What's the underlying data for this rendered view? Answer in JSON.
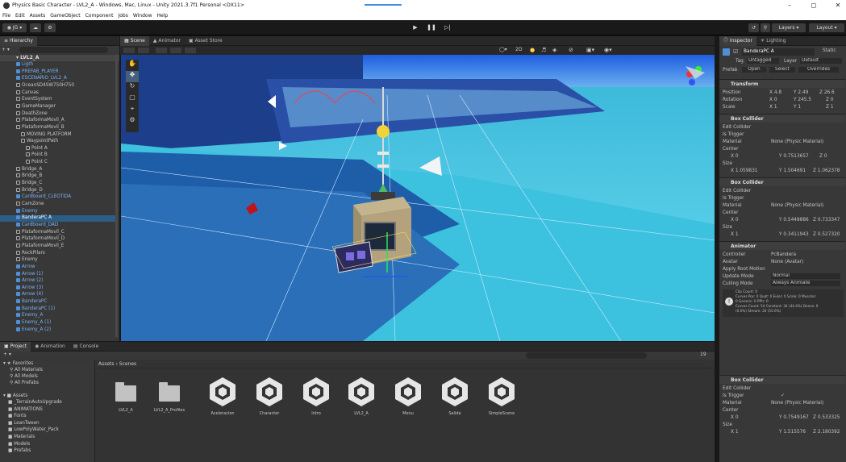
{
  "window": {
    "title": "Physics Basic Character - LVL2_A - Windows, Mac, Linux - Unity 2021.3.7f1 Personal <DX11>"
  },
  "menu": [
    "File",
    "Edit",
    "Assets",
    "GameObject",
    "Component",
    "Jobs",
    "Window",
    "Help"
  ],
  "toolbar": {
    "account": "JG",
    "layers": "Layers",
    "layout": "Layout"
  },
  "hierarchy": {
    "tab": "Hierarchy",
    "scene": "LVL2_A",
    "items": [
      {
        "label": "Ligth",
        "kind": "prefab",
        "indent": 1
      },
      {
        "label": "PREFAB_PLAYER",
        "kind": "prefab",
        "indent": 1
      },
      {
        "label": "ESCENARIO_LVL2_A",
        "kind": "prefab",
        "indent": 1
      },
      {
        "label": "OceanSD4SW750H750",
        "kind": "obj",
        "indent": 1
      },
      {
        "label": "Canvas",
        "kind": "obj",
        "indent": 1
      },
      {
        "label": "EventSystem",
        "kind": "obj",
        "indent": 1
      },
      {
        "label": "GameManager",
        "kind": "obj",
        "indent": 1
      },
      {
        "label": "DeathZone",
        "kind": "obj",
        "indent": 1
      },
      {
        "label": "PlataformaMovil_A",
        "kind": "obj",
        "indent": 1
      },
      {
        "label": "PlataformaMovil_B",
        "kind": "obj",
        "indent": 1
      },
      {
        "label": "MOVING PLATFORM",
        "kind": "obj",
        "indent": 2
      },
      {
        "label": "WaypointPath",
        "kind": "obj",
        "indent": 2
      },
      {
        "label": "Point A",
        "kind": "obj",
        "indent": 3
      },
      {
        "label": "Point B",
        "kind": "obj",
        "indent": 3
      },
      {
        "label": "Point C",
        "kind": "obj",
        "indent": 3
      },
      {
        "label": "Bridge_A",
        "kind": "obj",
        "indent": 1
      },
      {
        "label": "Bridge_B",
        "kind": "obj",
        "indent": 1
      },
      {
        "label": "Bridge_C",
        "kind": "obj",
        "indent": 1
      },
      {
        "label": "Bridge_D",
        "kind": "obj",
        "indent": 1
      },
      {
        "label": "Cardboard_CLEOTIDA",
        "kind": "prefab",
        "indent": 1
      },
      {
        "label": "CamZone",
        "kind": "obj",
        "indent": 1
      },
      {
        "label": "Enemy",
        "kind": "prefab",
        "indent": 1
      },
      {
        "label": "BanderaPC A",
        "kind": "prefab",
        "indent": 1,
        "selected": true
      },
      {
        "label": "Cardboard_DAD",
        "kind": "prefab",
        "indent": 1
      },
      {
        "label": "PlataformaMovil_C",
        "kind": "obj",
        "indent": 1
      },
      {
        "label": "PlataformaMovil_D",
        "kind": "obj",
        "indent": 1
      },
      {
        "label": "PlataformaMovil_E",
        "kind": "obj",
        "indent": 1
      },
      {
        "label": "RockPilars",
        "kind": "obj",
        "indent": 1
      },
      {
        "label": "Enemy",
        "kind": "obj",
        "indent": 1
      },
      {
        "label": "Arrow",
        "kind": "prefab",
        "indent": 1
      },
      {
        "label": "Arrow (1)",
        "kind": "prefab",
        "indent": 1
      },
      {
        "label": "Arrow (2)",
        "kind": "prefab",
        "indent": 1
      },
      {
        "label": "Arrow (3)",
        "kind": "prefab",
        "indent": 1
      },
      {
        "label": "Arrow (4)",
        "kind": "prefab",
        "indent": 1
      },
      {
        "label": "BanderaPC",
        "kind": "prefab",
        "indent": 1
      },
      {
        "label": "BanderaPC (1)",
        "kind": "prefab",
        "indent": 1
      },
      {
        "label": "Enemy_A",
        "kind": "prefab",
        "indent": 1
      },
      {
        "label": "Enemy_A (1)",
        "kind": "prefab",
        "indent": 1
      },
      {
        "label": "Enemy_A (2)",
        "kind": "prefab",
        "indent": 1
      }
    ]
  },
  "scene_tabs": [
    "Scene",
    "Animator",
    "Asset Store"
  ],
  "scene_toolbar": {
    "mode": "2D"
  },
  "inspector": {
    "tabs": [
      "Inspector",
      "Lighting"
    ],
    "object_name": "BanderaPC A",
    "static": "Static",
    "tag_label": "Tag",
    "tag": "Untagged",
    "layer_label": "Layer",
    "layer": "Default",
    "prefab_label": "Prefab",
    "prefab_buttons": [
      "Open",
      "Select",
      "Overrides"
    ],
    "transform": {
      "title": "Transform",
      "position_label": "Position",
      "position": {
        "x": "4.8",
        "y": "2.49",
        "z": "26.6"
      },
      "rotation_label": "Rotation",
      "rotation": {
        "x": "0",
        "y": "245.5",
        "z": "0"
      },
      "scale_label": "Scale",
      "scale": {
        "x": "1",
        "y": "1",
        "z": "1"
      }
    },
    "box_collider_1": {
      "title": "Box Collider",
      "edit": "Edit Collider",
      "is_trigger": "Is Trigger",
      "material_label": "Material",
      "material": "None (Physic Material)",
      "center_label": "Center",
      "center": {
        "x": "0",
        "y": "0.7513657",
        "z": "0"
      },
      "size_label": "Size",
      "size": {
        "x": "1.059831",
        "y": "1.504691",
        "z": "1.062378"
      }
    },
    "box_collider_2": {
      "title": "Box Collider",
      "edit": "Edit Collider",
      "is_trigger": "Is Trigger",
      "material_label": "Material",
      "material": "None (Physic Material)",
      "center_label": "Center",
      "center": {
        "x": "0",
        "y": "0.5448886",
        "z": "0.733347"
      },
      "size_label": "Size",
      "size": {
        "x": "1",
        "y": "0.3411943",
        "z": "0.527320"
      }
    },
    "animator": {
      "title": "Animator",
      "controller_label": "Controller",
      "controller": "PcBandera",
      "avatar_label": "Avatar",
      "avatar": "None (Avatar)",
      "root_motion": "Apply Root Motion",
      "update_label": "Update Mode",
      "update": "Normal",
      "culling_label": "Culling Mode",
      "culling": "Always Animate",
      "info": [
        "Clip Count: 0",
        "Curves Pos: 0 Quat: 0 Euler: 0 Scale: 0 Muscles:",
        "0 Generic: 0 PPtr: 0",
        "Curves Count: 54 Constant: 34 (44.4%) Dense: 0",
        "(0.0%) Stream: 20 (55.6%)"
      ]
    },
    "box_collider_3": {
      "title": "Box Collider",
      "edit": "Edit Collider",
      "is_trigger": "Is Trigger",
      "material_label": "Material",
      "material": "None (Physic Material)",
      "center_label": "Center",
      "center": {
        "x": "0",
        "y": "0.7549167",
        "z": "0.533325"
      },
      "size_label": "Size",
      "size": {
        "x": "1",
        "y": "1.515576",
        "z": "2.180392"
      }
    }
  },
  "bottom_tabs": [
    "Project",
    "Animation",
    "Console"
  ],
  "project": {
    "breadcrumb": [
      "Assets",
      "Scenes"
    ],
    "favorites_label": "Favorites",
    "favorites": [
      "All Materials",
      "All Models",
      "All Prefabs"
    ],
    "assets_label": "Assets",
    "folders": [
      "_TerrainAutoUpgrade",
      "ANIMATIONS",
      "Fonts",
      "LeanTween",
      "LowPolyWater_Pack",
      "Materials",
      "Models",
      "Prefabs"
    ],
    "count": "19",
    "items": [
      {
        "label": "LVL2_A",
        "type": "folder"
      },
      {
        "label": "LVL2_A_Profiles",
        "type": "folder"
      },
      {
        "label": "Aceleracion",
        "type": "scene"
      },
      {
        "label": "Character",
        "type": "scene"
      },
      {
        "label": "Intro",
        "type": "scene"
      },
      {
        "label": "LVL2_A",
        "type": "scene"
      },
      {
        "label": "Menu",
        "type": "scene"
      },
      {
        "label": "Salida",
        "type": "scene"
      },
      {
        "label": "SimpleScene",
        "type": "scene"
      }
    ]
  }
}
